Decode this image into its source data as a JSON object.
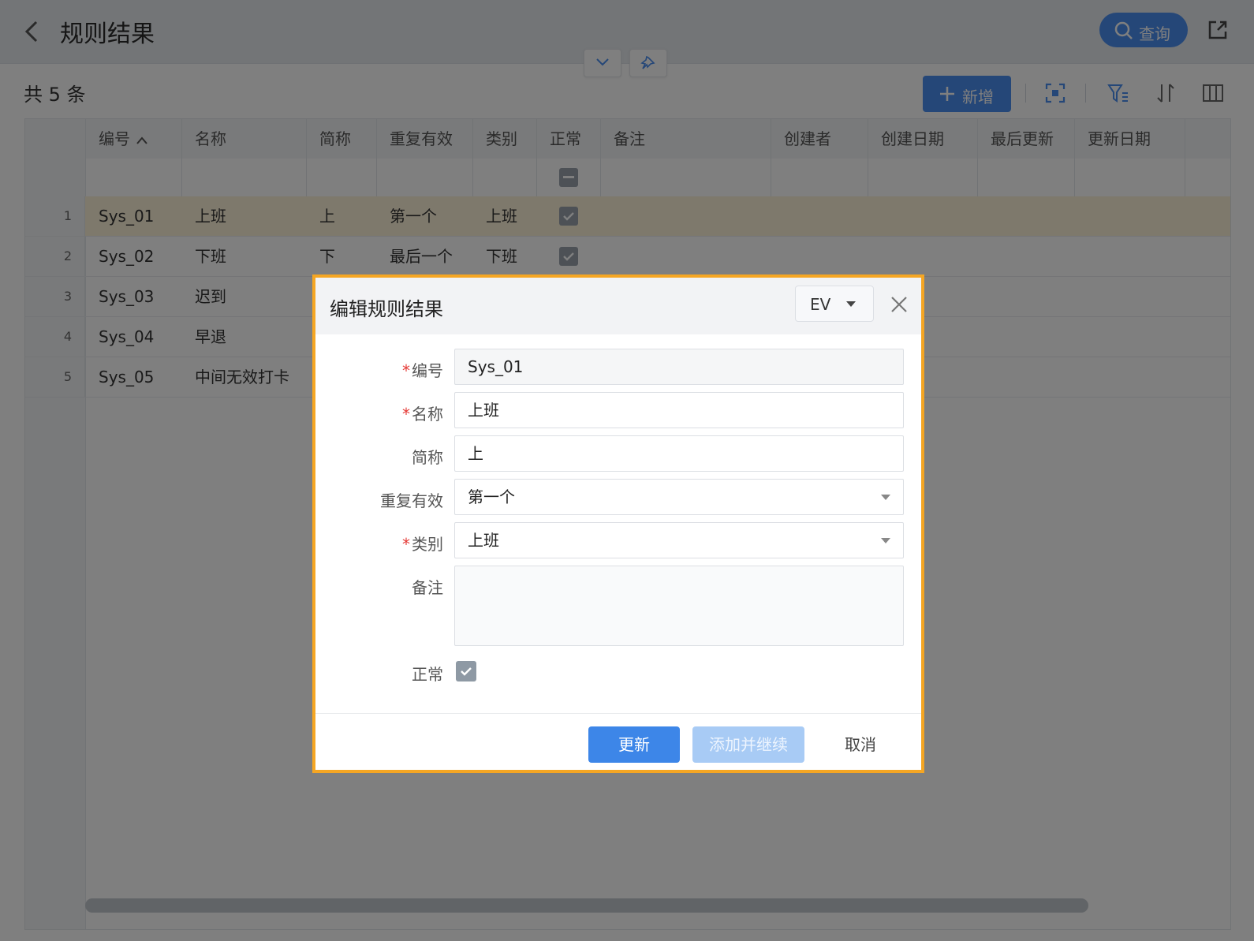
{
  "header": {
    "title": "规则结果",
    "query_label": "查询"
  },
  "toolbar": {
    "record_count": "共 5 条",
    "add_label": "新增"
  },
  "table": {
    "columns": [
      "编号",
      "名称",
      "简称",
      "重复有效",
      "类别",
      "正常",
      "备注",
      "创建者",
      "创建日期",
      "最后更新",
      "更新日期"
    ],
    "rows": [
      {
        "num": "1",
        "code": "Sys_01",
        "name": "上班",
        "short": "上",
        "repeat": "第一个",
        "category": "上班",
        "normal": true
      },
      {
        "num": "2",
        "code": "Sys_02",
        "name": "下班",
        "short": "下",
        "repeat": "最后一个",
        "category": "下班",
        "normal": true
      },
      {
        "num": "3",
        "code": "Sys_03",
        "name": "迟到",
        "short": "",
        "repeat": "",
        "category": "",
        "normal": false
      },
      {
        "num": "4",
        "code": "Sys_04",
        "name": "早退",
        "short": "",
        "repeat": "",
        "category": "",
        "normal": false
      },
      {
        "num": "5",
        "code": "Sys_05",
        "name": "中间无效打卡",
        "short": "",
        "repeat": "",
        "category": "",
        "normal": false
      }
    ]
  },
  "dialog": {
    "title": "编辑规则结果",
    "language": "EV",
    "fields": {
      "code": {
        "label": "编号",
        "value": "Sys_01",
        "required": true
      },
      "name": {
        "label": "名称",
        "value": "上班",
        "required": true
      },
      "short": {
        "label": "简称",
        "value": "上",
        "required": false
      },
      "repeat": {
        "label": "重复有效",
        "value": "第一个",
        "required": false
      },
      "category": {
        "label": "类别",
        "value": "上班",
        "required": true
      },
      "remark": {
        "label": "备注",
        "value": "",
        "required": false
      },
      "normal": {
        "label": "正常",
        "checked": true
      }
    },
    "buttons": {
      "update": "更新",
      "add_continue": "添加并继续",
      "cancel": "取消"
    }
  },
  "icons": [
    "back-icon",
    "search-icon",
    "export-icon",
    "chevron-down-icon",
    "pin-icon",
    "plus-icon",
    "fullscreen-icon",
    "filter-icon",
    "sort-icon",
    "columns-icon",
    "close-icon",
    "caret-down-icon",
    "check-icon"
  ],
  "colors": {
    "primary": "#4a8ef0",
    "dialog_border": "#f5a623",
    "selected_row": "#fdf2d9",
    "required": "#e53935"
  }
}
